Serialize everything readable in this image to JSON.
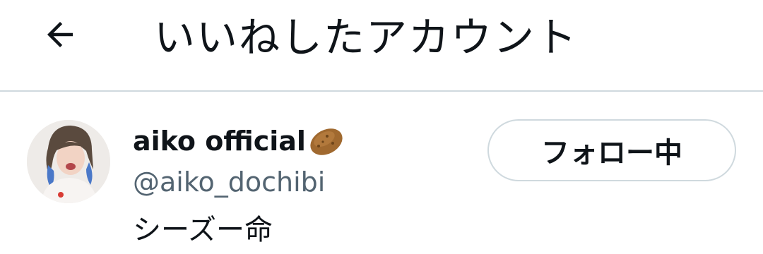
{
  "header": {
    "title": "いいねしたアカウント",
    "back_icon": "arrow-left-icon"
  },
  "users": [
    {
      "display_name": "aiko official",
      "name_emoji": "potato-icon",
      "handle": "@aiko_dochibi",
      "bio": "シーズー命",
      "follow_label": "フォロー中"
    }
  ],
  "colors": {
    "text_primary": "#0f1419",
    "text_secondary": "#536471",
    "border": "#cfd9de",
    "background": "#ffffff"
  }
}
